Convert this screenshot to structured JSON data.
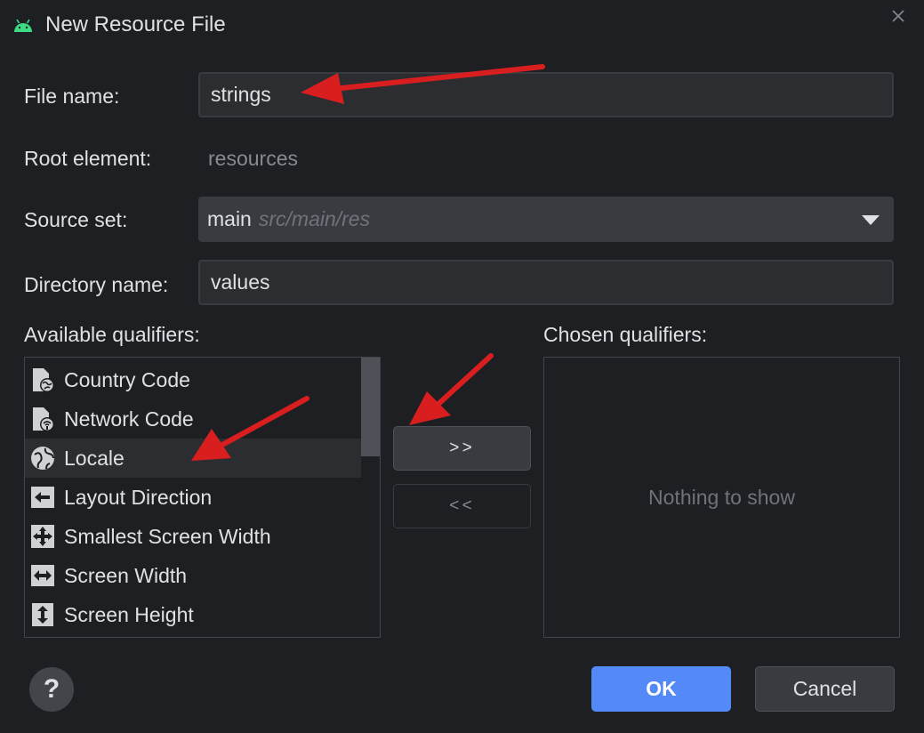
{
  "window": {
    "title": "New Resource File",
    "icon": "android-icon",
    "close_icon": "close-icon"
  },
  "form": {
    "file_name_label": "File name:",
    "file_name_value": "strings",
    "root_element_label": "Root element:",
    "root_element_value": "resources",
    "source_set_label": "Source set:",
    "source_set_value": "main",
    "source_set_path": "src/main/res",
    "directory_name_label": "Directory name:",
    "directory_name_value": "values"
  },
  "qualifiers": {
    "available_label": "Available qualifiers:",
    "chosen_label": "Chosen qualifiers:",
    "available": [
      {
        "label": "Country Code",
        "icon": "country-code-icon"
      },
      {
        "label": "Network Code",
        "icon": "network-code-icon"
      },
      {
        "label": "Locale",
        "icon": "globe-icon",
        "selected": true
      },
      {
        "label": "Layout Direction",
        "icon": "layout-direction-icon"
      },
      {
        "label": "Smallest Screen Width",
        "icon": "smallest-screen-width-icon"
      },
      {
        "label": "Screen Width",
        "icon": "screen-width-icon"
      },
      {
        "label": "Screen Height",
        "icon": "screen-height-icon"
      }
    ],
    "empty_text": "Nothing to show",
    "add_label": ">>",
    "remove_label": "<<"
  },
  "footer": {
    "help_label": "?",
    "ok_label": "OK",
    "cancel_label": "Cancel"
  },
  "colors": {
    "background": "#1e1f22",
    "field": "#2b2d30",
    "accent": "#548af7",
    "annotation_arrow": "#e01e1e"
  }
}
